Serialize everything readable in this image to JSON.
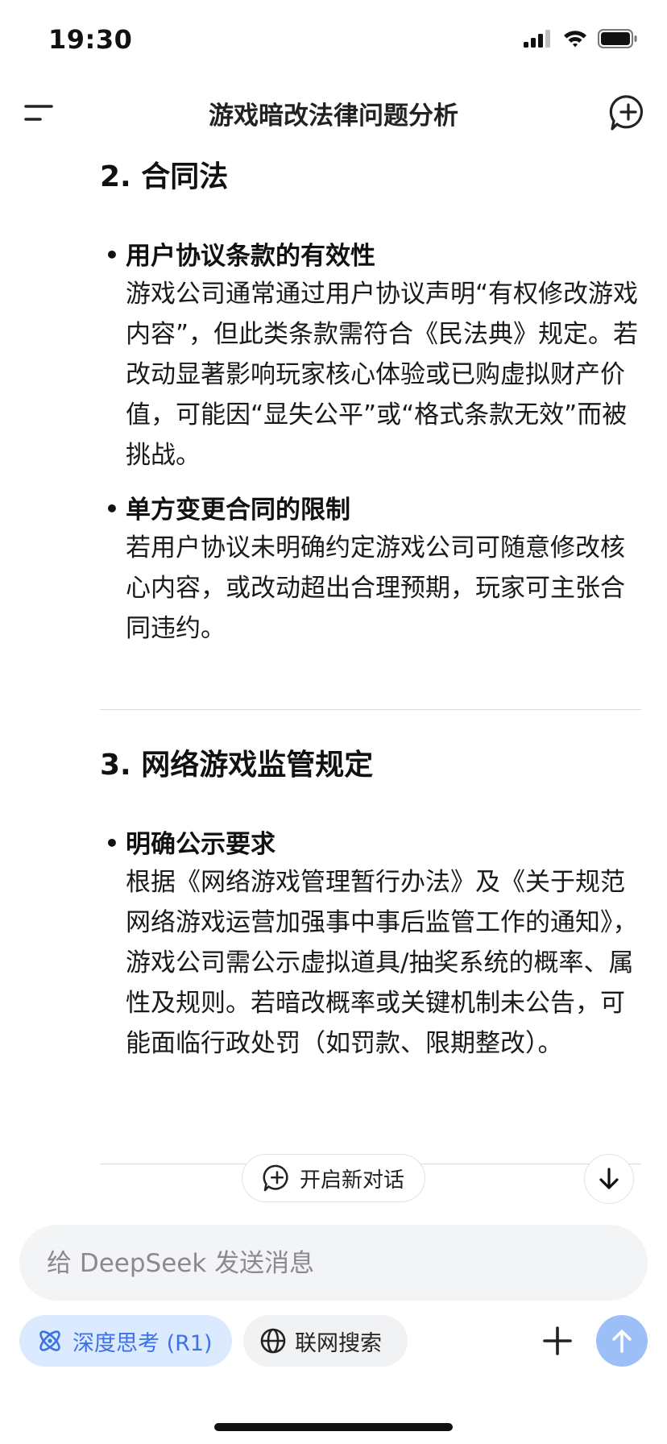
{
  "status": {
    "time": "19:30"
  },
  "header": {
    "title": "游戏暗改法律问题分析"
  },
  "sections": [
    {
      "heading": "2. 合同法",
      "bullets": [
        {
          "title": "用户协议条款的有效性",
          "body": "游戏公司通常通过用户协议声明“有权修改游戏内容”，但此类条款需符合《民法典》规定。若改动显著影响玩家核心体验或已购虚拟财产价值，可能因“显失公平”或“格式条款无效”而被挑战。"
        },
        {
          "title": "单方变更合同的限制",
          "body": "若用户协议未明确约定游戏公司可随意修改核心内容，或改动超出合理预期，玩家可主张合同违约。"
        }
      ]
    },
    {
      "heading": "3. 网络游戏监管规定",
      "bullets": [
        {
          "title": "明确公示要求",
          "body": "根据《网络游戏管理暂行办法》及《关于规范网络游戏运营加强事中事后监管工作的通知》，游戏公司需公示虚拟道具/抽奖系统的概率、属性及规则。若暗改概率或关键机制未公告，可能面临行政处罚（如罚款、限期整改）。"
        }
      ]
    }
  ],
  "floating": {
    "new_chat_label": "开启新对话"
  },
  "composer": {
    "placeholder": "给 DeepSeek 发送消息",
    "deep_think_label": "深度思考 (R1)",
    "web_search_label": "联网搜索"
  },
  "icons": {
    "menu": "menu-icon",
    "new_chat": "new-chat-icon",
    "scroll_down": "arrow-down-icon",
    "deep_think": "atom-icon",
    "web_search": "globe-icon",
    "add": "plus-icon",
    "send": "arrow-up-icon"
  },
  "colors": {
    "accent": "#3b72e6",
    "send_button": "#9dbff7",
    "deep_think_bg": "#dbeafe"
  }
}
